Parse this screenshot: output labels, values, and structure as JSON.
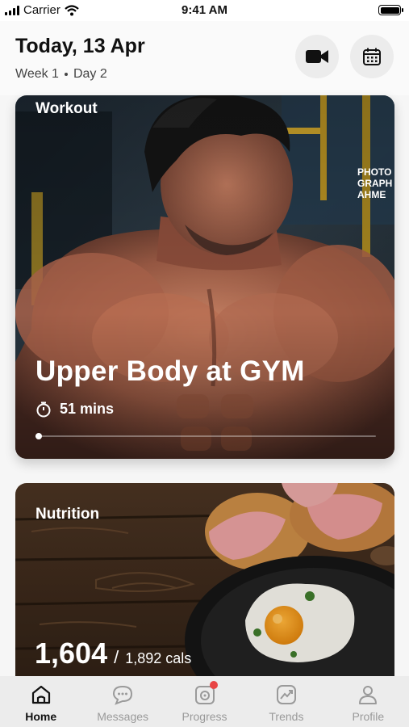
{
  "status_bar": {
    "carrier": "Carrier",
    "time": "9:41 AM"
  },
  "header": {
    "date": "Today, 13 Apr",
    "week": "Week 1",
    "day": "Day 2",
    "video_icon": "video-camera-icon",
    "calendar_icon": "calendar-icon"
  },
  "workout_card": {
    "label": "Workout",
    "title": "Upper Body at GYM",
    "duration": "51 mins",
    "progress": 0.01,
    "watermark": [
      "PHOTO",
      "GRAPH",
      "AHME"
    ]
  },
  "nutrition_card": {
    "label": "Nutrition",
    "calories_consumed": "1,604",
    "separator": "/",
    "calories_goal": "1,892 cals"
  },
  "tab_bar": {
    "active": "Home",
    "items": [
      {
        "label": "Home",
        "icon": "home-icon"
      },
      {
        "label": "Messages",
        "icon": "message-icon"
      },
      {
        "label": "Progress",
        "icon": "camera-icon"
      },
      {
        "label": "Trends",
        "icon": "trend-icon"
      },
      {
        "label": "Profile",
        "icon": "profile-icon"
      }
    ]
  },
  "colors": {
    "badge": "#e84545",
    "active_tab": "#111111",
    "inactive_tab": "#9a9a9a"
  }
}
